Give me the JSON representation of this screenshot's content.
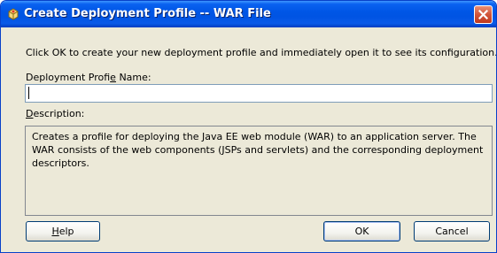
{
  "window": {
    "title": "Create Deployment Profile -- WAR File",
    "icon": "deployment-profile-icon",
    "close_icon": "close-icon"
  },
  "dialog": {
    "instruction": "Click OK to create your new deployment profile and immediately open it to see its configuration.",
    "name_label": {
      "before": "Deployment Profi",
      "mnemonic": "e",
      "after": " Name:",
      "rest": "le Name:"
    },
    "name_value": "",
    "description_label": {
      "mnemonic": "D",
      "rest": "escription:"
    },
    "description": "Creates a profile for deploying the Java EE web module (WAR) to an application server. The WAR consists of the web components (JSPs and servlets) and the corresponding deployment descriptors."
  },
  "buttons": {
    "help": {
      "mnemonic": "H",
      "rest": "elp"
    },
    "ok": "OK",
    "cancel": "Cancel"
  },
  "colors": {
    "titlebar": "#0054e3",
    "dialog_background": "#ece9d8",
    "close_button": "#d1553a"
  }
}
